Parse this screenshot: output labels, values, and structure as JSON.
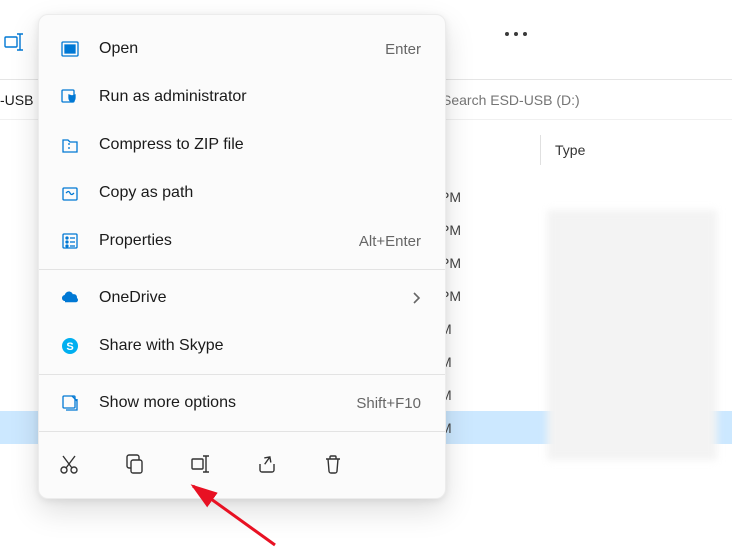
{
  "toolbar": {
    "ellipsis_label": "See more"
  },
  "address": {
    "fragment": "-USB"
  },
  "search": {
    "placeholder": "Search ESD-USB (D:)"
  },
  "columns": {
    "type_label": "Type"
  },
  "rows": [
    {
      "date": "PM",
      "selected": false
    },
    {
      "date": "PM",
      "selected": false
    },
    {
      "date": "PM",
      "selected": false
    },
    {
      "date": "PM",
      "selected": false
    },
    {
      "date": "M",
      "selected": false
    },
    {
      "date": "M",
      "selected": false
    },
    {
      "date": "M",
      "selected": false
    },
    {
      "date": "M",
      "selected": true
    }
  ],
  "context_menu": {
    "open": {
      "label": "Open",
      "shortcut": "Enter"
    },
    "run_admin": {
      "label": "Run as administrator"
    },
    "zip": {
      "label": "Compress to ZIP file"
    },
    "copy_path": {
      "label": "Copy as path"
    },
    "properties": {
      "label": "Properties",
      "shortcut": "Alt+Enter"
    },
    "onedrive": {
      "label": "OneDrive"
    },
    "skype": {
      "label": "Share with Skype"
    },
    "show_more": {
      "label": "Show more options",
      "shortcut": "Shift+F10"
    },
    "action_icons": {
      "cut": "Cut",
      "copy": "Copy",
      "rename": "Rename",
      "share": "Share",
      "delete": "Delete"
    }
  }
}
